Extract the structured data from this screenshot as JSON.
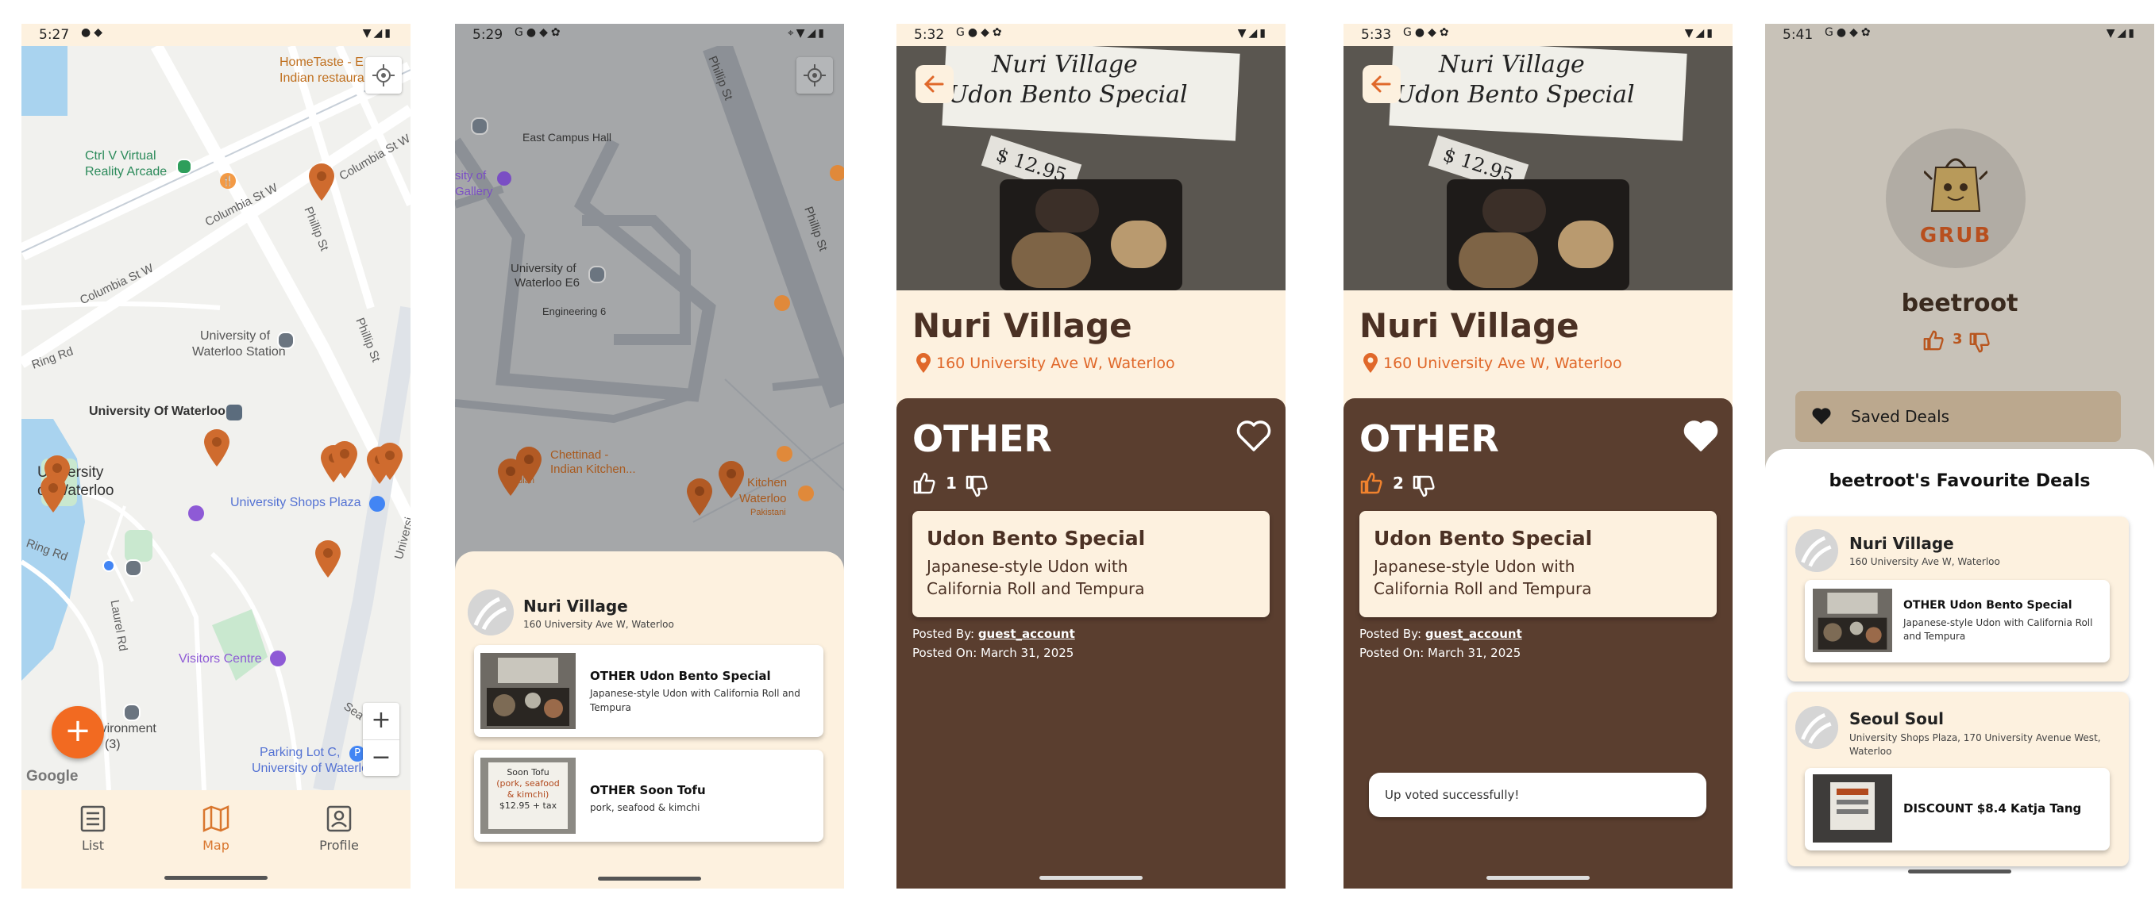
{
  "colors": {
    "accent": "#f26a21",
    "pin": "#cf6b2e",
    "brown": "#5a3e2f",
    "cream": "#fdf1df"
  },
  "screen1": {
    "time": "5:27",
    "map_labels": {
      "hometaste": "HomeTaste - E",
      "hometaste2": "Indian restaura",
      "ctrlv": "Ctrl V Virtual",
      "ctrlv2": "Reality Arcade",
      "columbia_st_w1": "Columbia St W",
      "columbia_st_w2": "Columbia St W",
      "columbia_st_w3": "Columbia St W",
      "phillip_st": "Phillip St",
      "phillip_st2": "Phillip St",
      "ring_rd": "Ring Rd",
      "uw_station": "University of",
      "uw_station2": "Waterloo Station",
      "uow": "University Of Waterloo",
      "university_of": "University",
      "waterloo": "of Waterloo",
      "shops_plaza": "University Shops Plaza",
      "ring_rd2": "Ring Rd",
      "laurel_rd": "Laurel Rd",
      "visitors_centre": "Visitors Centre",
      "environment": "Environment",
      "environment2": "(3)",
      "seagram": "Sea",
      "parking": "Parking Lot C,",
      "parking2": "University of Waterloo",
      "university_ave": "Universi",
      "google": "Google"
    },
    "fab_label": "+",
    "zoom_in": "+",
    "zoom_out": "−",
    "nav": {
      "list": "List",
      "map": "Map",
      "profile": "Profile"
    }
  },
  "screen2": {
    "time": "5:29",
    "map_labels": {
      "phillip_st": "Phillip St",
      "phillip_st2": "Phillip St",
      "east_campus": "East Campus Hall",
      "sity_of": "sity of",
      "gallery": "Gallery",
      "uw_e6": "University of",
      "uw_e6b": "Waterloo E6",
      "eng6": "Engineering 6",
      "chettinad": "Chettinad -",
      "chettinad2": "Indian Kitchen...",
      "indian": "Indian",
      "kitchen": "Kitchen",
      "waterloo": "Waterloo",
      "pakistani": "Pakistani"
    },
    "sheet": {
      "name": "Nuri Village",
      "address": "160 University Ave W, Waterloo",
      "deals": [
        {
          "title": "OTHER Udon Bento Special",
          "desc": "Japanese-style Udon with California Roll and Tempura"
        },
        {
          "title": "OTHER Soon Tofu",
          "desc": "pork, seafood & kimchi"
        }
      ],
      "thumb2_text": [
        "Soon Tofu",
        "(pork, seafood",
        "& kimchi)",
        "$12.95 + tax"
      ]
    }
  },
  "screen3": {
    "time": "5:32",
    "photo_text": {
      "line1": "Nuri Village",
      "line2": "Udon Bento Special",
      "price": "$ 12.95"
    },
    "name": "Nuri Village",
    "address": "160 University Ave W, Waterloo",
    "category": "OTHER",
    "votes": "1",
    "deal_title": "Udon Bento Special",
    "deal_desc_1": "Japanese-style Udon with",
    "deal_desc_2": "California Roll and Tempura",
    "posted_by_label": "Posted By: ",
    "posted_by": "guest_account",
    "posted_on": "Posted On: March 31, 2025"
  },
  "screen4": {
    "time": "5:33",
    "photo_text": {
      "line1": "Nuri Village",
      "line2": "Udon Bento Special",
      "price": "$ 12.95"
    },
    "name": "Nuri Village",
    "address": "160 University Ave W, Waterloo",
    "category": "OTHER",
    "votes": "2",
    "deal_title": "Udon Bento Special",
    "deal_desc_1": "Japanese-style Udon with",
    "deal_desc_2": "California Roll and Tempura",
    "posted_by_label": "Posted By: ",
    "posted_by": "guest_account",
    "posted_on": "Posted On: March 31, 2025",
    "toast": "Up voted successfully!"
  },
  "screen5": {
    "time": "5:41",
    "logo_text": "GRUB",
    "username": "beetroot",
    "votes": "3",
    "saved_deals": "Saved Deals",
    "favs_title": "beetroot's Favourite Deals",
    "restaurants": [
      {
        "name": "Nuri Village",
        "address": "160 University Ave W, Waterloo",
        "deal_title": "OTHER Udon Bento Special",
        "deal_desc": "Japanese-style Udon with California Roll and Tempura"
      },
      {
        "name": "Seoul Soul",
        "address": "University Shops Plaza, 170 University Avenue West, Waterloo",
        "deal_title": "DISCOUNT $8.4 Katja Tang",
        "deal_desc": ""
      }
    ]
  }
}
